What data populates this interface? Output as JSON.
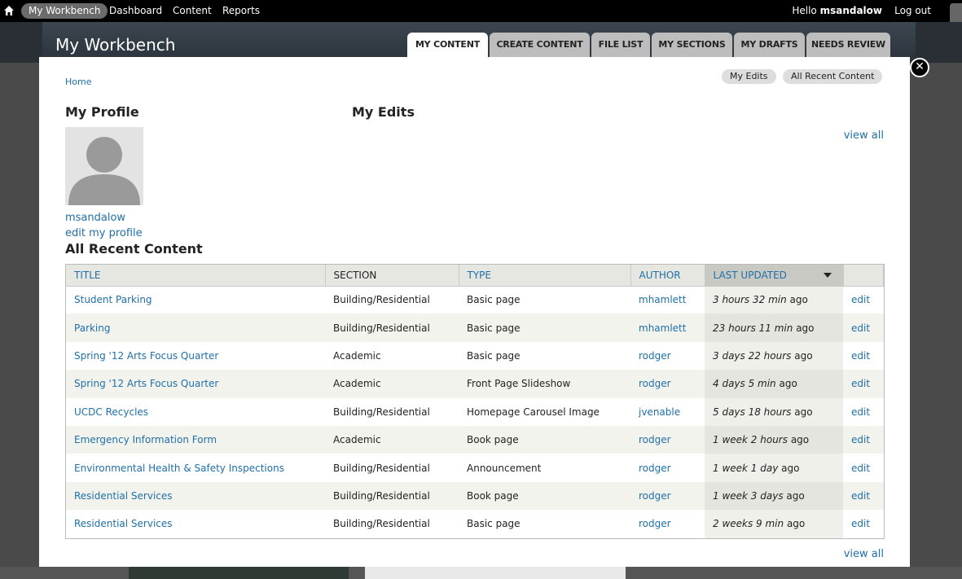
{
  "toolbar": {
    "items": [
      "My Workbench",
      "Dashboard",
      "Content",
      "Reports"
    ],
    "hello_prefix": "Hello",
    "username": "msandalow",
    "logout": "Log out"
  },
  "site_title": "My Workbench",
  "tabs": [
    "MY CONTENT",
    "CREATE CONTENT",
    "FILE LIST",
    "MY SECTIONS",
    "MY DRAFTS",
    "NEEDS REVIEW"
  ],
  "breadcrumb": "Home",
  "pills": [
    "My Edits",
    "All Recent Content"
  ],
  "profile": {
    "heading": "My Profile",
    "username": "msandalow",
    "edit_link": "edit my profile"
  },
  "my_edits": {
    "heading": "My Edits",
    "view_all": "view all"
  },
  "recent": {
    "heading": "All Recent Content",
    "view_all": "view all",
    "columns": [
      "TITLE",
      "SECTION",
      "TYPE",
      "AUTHOR",
      "LAST UPDATED",
      ""
    ],
    "rows": [
      {
        "title": "Student Parking",
        "section": "Building/Residential",
        "type": "Basic page",
        "author": "mhamlett",
        "updated": "3 hours 32 min",
        "ago": "ago",
        "action": "edit"
      },
      {
        "title": "Parking",
        "section": "Building/Residential",
        "type": "Basic page",
        "author": "mhamlett",
        "updated": "23 hours 11 min",
        "ago": "ago",
        "action": "edit"
      },
      {
        "title": "Spring '12 Arts Focus Quarter",
        "section": "Academic",
        "type": "Basic page",
        "author": "rodger",
        "updated": "3 days 22 hours",
        "ago": "ago",
        "action": "edit"
      },
      {
        "title": "Spring '12 Arts Focus Quarter",
        "section": "Academic",
        "type": "Front Page Slideshow",
        "author": "rodger",
        "updated": "4 days 5 min",
        "ago": "ago",
        "action": "edit"
      },
      {
        "title": "UCDC Recycles",
        "section": "Building/Residential",
        "type": "Homepage Carousel Image",
        "author": "jvenable",
        "updated": "5 days 18 hours",
        "ago": "ago",
        "action": "edit"
      },
      {
        "title": "Emergency Information Form",
        "section": "Academic",
        "type": "Book page",
        "author": "rodger",
        "updated": "1 week 2 hours",
        "ago": "ago",
        "action": "edit"
      },
      {
        "title": "Environmental Health & Safety Inspections",
        "section": "Building/Residential",
        "type": "Announcement",
        "author": "rodger",
        "updated": "1 week 1 day",
        "ago": "ago",
        "action": "edit"
      },
      {
        "title": "Residential Services",
        "section": "Building/Residential",
        "type": "Book page",
        "author": "rodger",
        "updated": "1 week 3 days",
        "ago": "ago",
        "action": "edit"
      },
      {
        "title": "Residential Services",
        "section": "Building/Residential",
        "type": "Basic page",
        "author": "rodger",
        "updated": "2 weeks 9 min",
        "ago": "ago",
        "action": "edit"
      }
    ]
  }
}
